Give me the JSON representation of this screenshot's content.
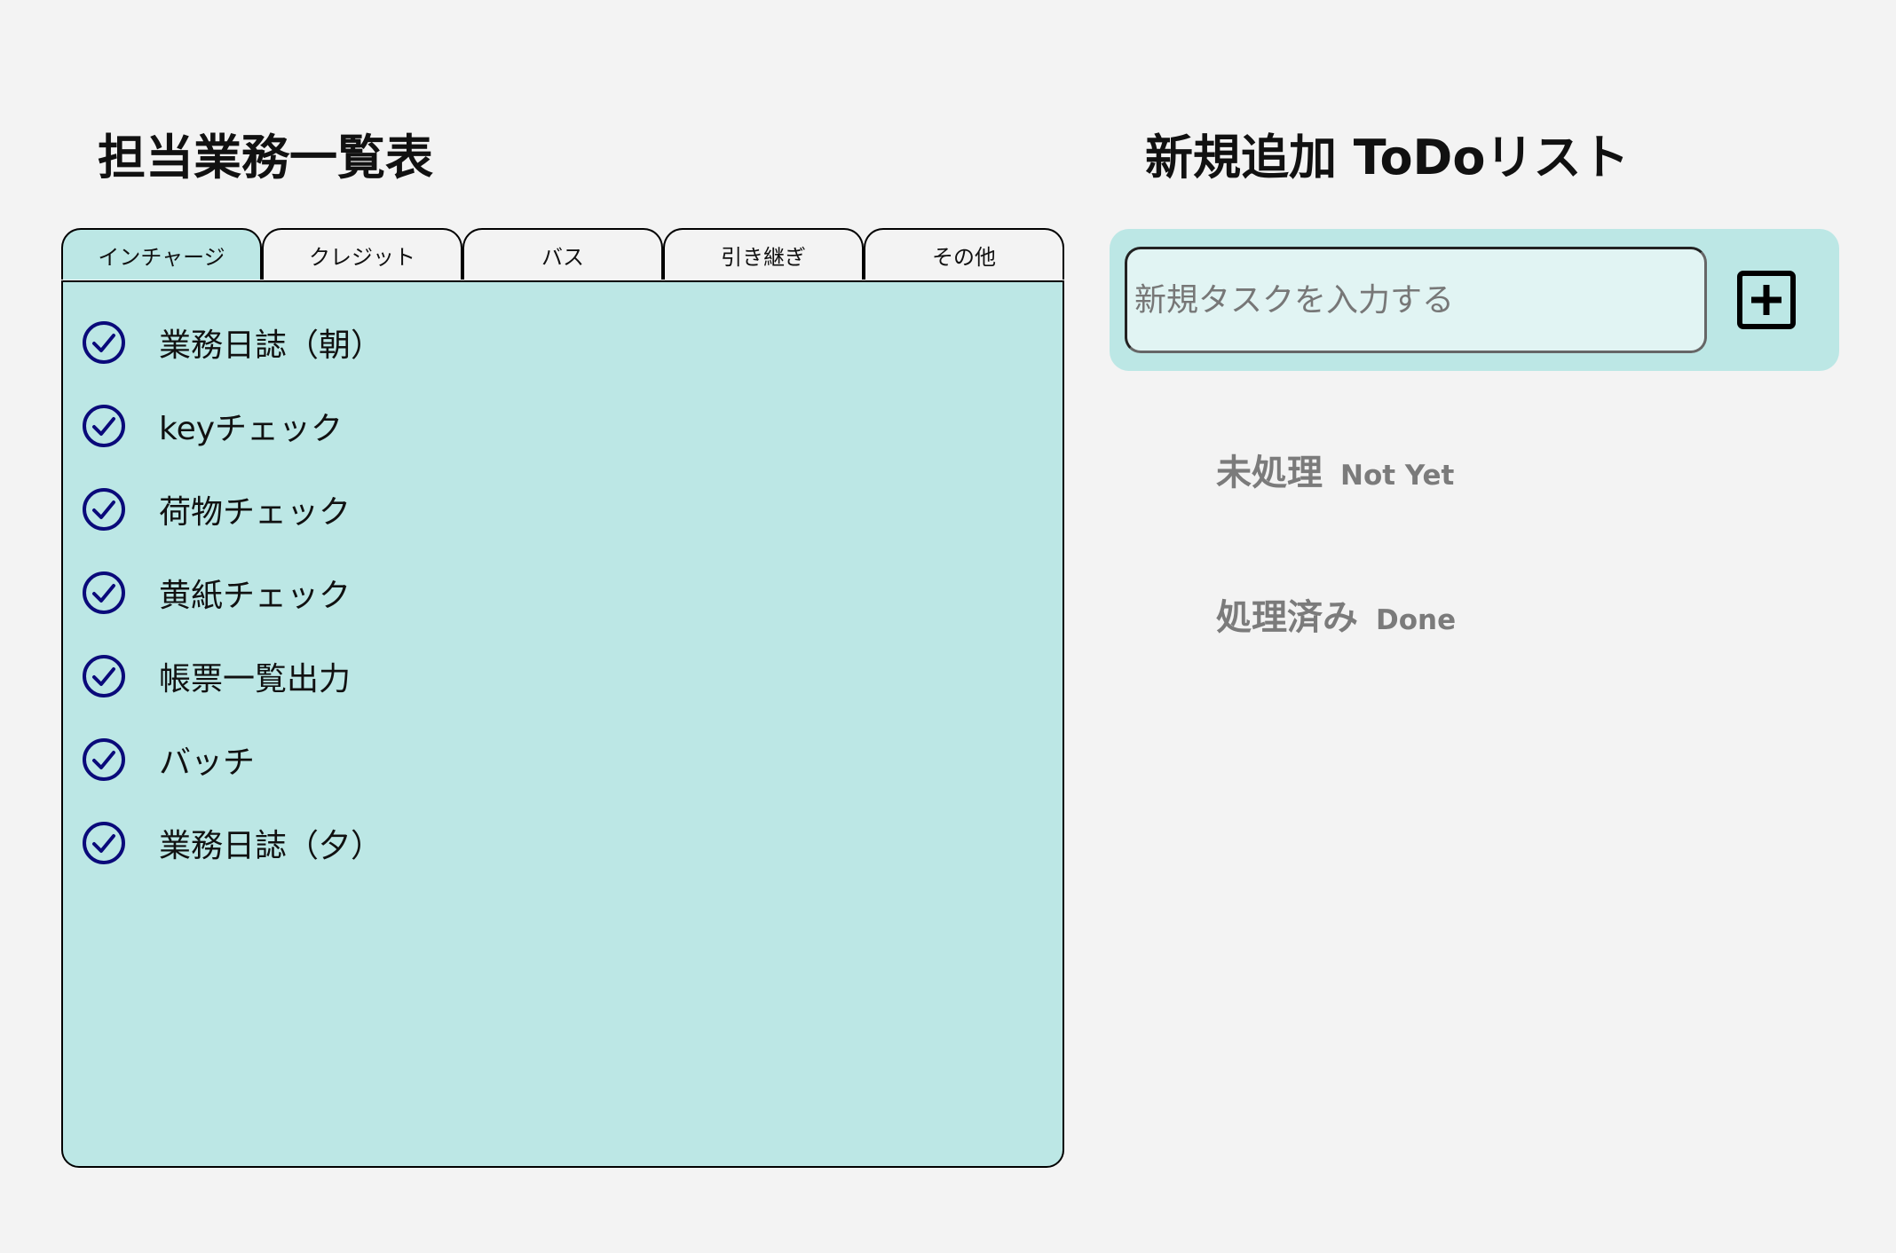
{
  "left": {
    "title": "担当業務一覧表",
    "tabs": [
      "インチャージ",
      "クレジット",
      "バス",
      "引き継ぎ",
      "その他"
    ],
    "active_tab": 0,
    "tasks": [
      "業務日誌（朝）",
      "keyチェック",
      "荷物チェック",
      "黄紙チェック",
      "帳票一覧出力",
      "バッチ",
      "業務日誌（夕）"
    ]
  },
  "right": {
    "title": "新規追加 ToDoリスト",
    "input": {
      "placeholder": "新規タスクを入力する",
      "value": ""
    },
    "add_icon": "plus-square-icon",
    "sections": {
      "not_yet": {
        "jp": "未処理",
        "en": "Not Yet"
      },
      "done": {
        "jp": "処理済み",
        "en": "Done"
      }
    }
  },
  "colors": {
    "background": "#f3f3f3",
    "panel": "#bce7e5",
    "input_bg": "#e1f4f3",
    "check": "#0a0a7a",
    "muted_text": "#7b7b7b"
  }
}
